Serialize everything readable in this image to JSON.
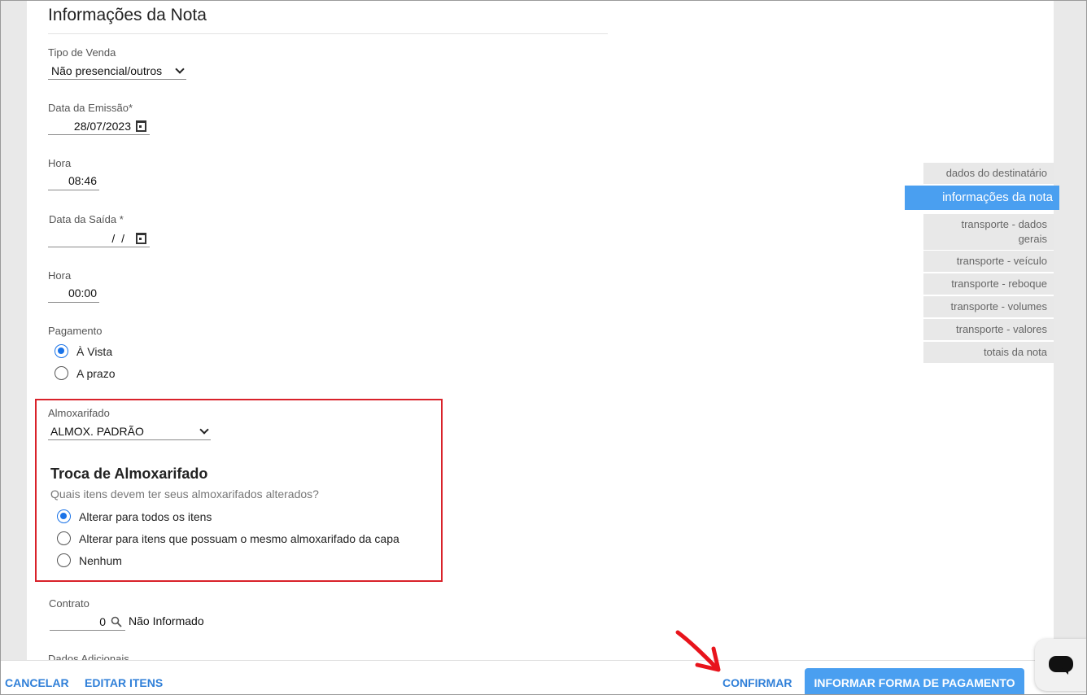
{
  "header": {
    "title": "Informações da Nota"
  },
  "fields": {
    "tipo_venda": {
      "label": "Tipo de Venda",
      "value": "Não presencial/outros"
    },
    "data_emissao": {
      "label": "Data da Emissão*",
      "value": "28/07/2023"
    },
    "hora_emissao": {
      "label": "Hora",
      "value": "08:46"
    },
    "data_saida": {
      "label": "Data da Saída *",
      "value": " /  /"
    },
    "hora_saida": {
      "label": "Hora",
      "value": "00:00"
    },
    "pagamento": {
      "label": "Pagamento",
      "options": [
        {
          "label": "À Vista",
          "checked": true
        },
        {
          "label": "A prazo",
          "checked": false
        }
      ]
    },
    "almoxarifado": {
      "label": "Almoxarifado",
      "value": "ALMOX. PADRÃO"
    },
    "troca": {
      "title": "Troca de Almoxarifado",
      "question": "Quais itens devem ter seus almoxarifados alterados?",
      "options": [
        {
          "label": "Alterar para todos os itens",
          "checked": true
        },
        {
          "label": "Alterar para itens que possuam o mesmo almoxarifado da capa",
          "checked": false
        },
        {
          "label": "Nenhum",
          "checked": false
        }
      ]
    },
    "contrato": {
      "label": "Contrato",
      "value": "0",
      "status": "Não Informado"
    },
    "dados_adicionais": {
      "label": "Dados Adicionais"
    }
  },
  "sidebar": {
    "items": [
      {
        "label": "dados do destinatário",
        "active": false
      },
      {
        "label": "informações da nota",
        "active": true
      },
      {
        "label": "transporte - dados gerais",
        "active": false
      },
      {
        "label": "transporte - veículo",
        "active": false
      },
      {
        "label": "transporte - reboque",
        "active": false
      },
      {
        "label": "transporte - volumes",
        "active": false
      },
      {
        "label": "transporte - valores",
        "active": false
      },
      {
        "label": "totais da nota",
        "active": false
      }
    ]
  },
  "footer": {
    "cancel_label": "CANCELAR",
    "edit_items_label": "EDITAR ITENS",
    "confirm_label": "CONFIRMAR",
    "payment_label": "INFORMAR FORMA DE PAGAMENTO"
  },
  "colors": {
    "accent": "#4a9ff0",
    "link": "#2f7fd8",
    "highlight_border": "#d9222a",
    "annotation_arrow": "#e8141c"
  },
  "icons": [
    "calendar-icon",
    "search-icon",
    "chevron-down-icon",
    "chat-icon"
  ]
}
